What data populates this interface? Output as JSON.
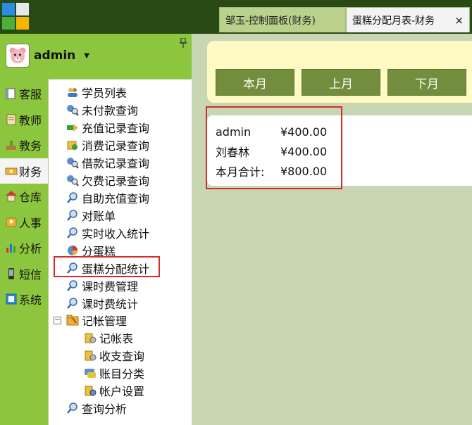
{
  "tabs": [
    {
      "label": "邹玉-控制面板(财务)"
    },
    {
      "label": "蛋糕分配月表-财务",
      "close": "×"
    }
  ],
  "user": {
    "name": "admin",
    "caret": "▼"
  },
  "categories": [
    {
      "label": "客服",
      "icon": "book-icon"
    },
    {
      "label": "教师",
      "icon": "scroll-icon"
    },
    {
      "label": "教务",
      "icon": "tools-icon"
    },
    {
      "label": "财务",
      "icon": "money-icon",
      "active": true
    },
    {
      "label": "仓库",
      "icon": "house-icon"
    },
    {
      "label": "人事",
      "icon": "badge-icon"
    },
    {
      "label": "分析",
      "icon": "bar-chart-icon"
    },
    {
      "label": "短信",
      "icon": "phone-icon"
    },
    {
      "label": "系统",
      "icon": "system-icon"
    }
  ],
  "tree": [
    {
      "label": "学员列表",
      "icon": "users-icon"
    },
    {
      "label": "未付款查询",
      "icon": "search-user-icon"
    },
    {
      "label": "充值记录查询",
      "icon": "recharge-icon"
    },
    {
      "label": "消费记录查询",
      "icon": "consume-icon"
    },
    {
      "label": "借款记录查询",
      "icon": "search-user-icon"
    },
    {
      "label": "欠费记录查询",
      "icon": "search-user-icon"
    },
    {
      "label": "自助充值查询",
      "icon": "magnifier-icon"
    },
    {
      "label": "对账单",
      "icon": "magnifier-icon"
    },
    {
      "label": "实时收入统计",
      "icon": "magnifier-icon"
    },
    {
      "label": "分蛋糕",
      "icon": "pie-icon"
    },
    {
      "label": "蛋糕分配统计",
      "icon": "magnifier-icon",
      "highlighted": true
    },
    {
      "label": "课时费管理",
      "icon": "magnifier-icon"
    },
    {
      "label": "课时费统计",
      "icon": "magnifier-icon"
    },
    {
      "label": "记帐管理",
      "icon": "folder-icon",
      "expanded": true
    },
    {
      "label": "记帐表",
      "icon": "coins-icon",
      "child": true
    },
    {
      "label": "收支查询",
      "icon": "coins-icon",
      "child": true
    },
    {
      "label": "账目分类",
      "icon": "chat-icon",
      "child": true
    },
    {
      "label": "帐户设置",
      "icon": "coins-icon",
      "child": true
    },
    {
      "label": "查询分析",
      "icon": "magnifier-icon"
    }
  ],
  "tree_expand_symbol": "−",
  "buttons": {
    "this_month": "本月",
    "last_month": "上月",
    "next_month": "下月"
  },
  "summary": [
    {
      "label": "admin",
      "value": "¥400.00"
    },
    {
      "label": "刘春林",
      "value": "¥400.00"
    },
    {
      "label": "本月合计:",
      "value": "¥800.00"
    }
  ],
  "colors": {
    "sidebar_green": "#8cc63e",
    "top_bar": "#294a14",
    "button_green": "#728e3c",
    "highlight_red": "#d62b2b",
    "panel_yellow": "#fff9c4"
  }
}
